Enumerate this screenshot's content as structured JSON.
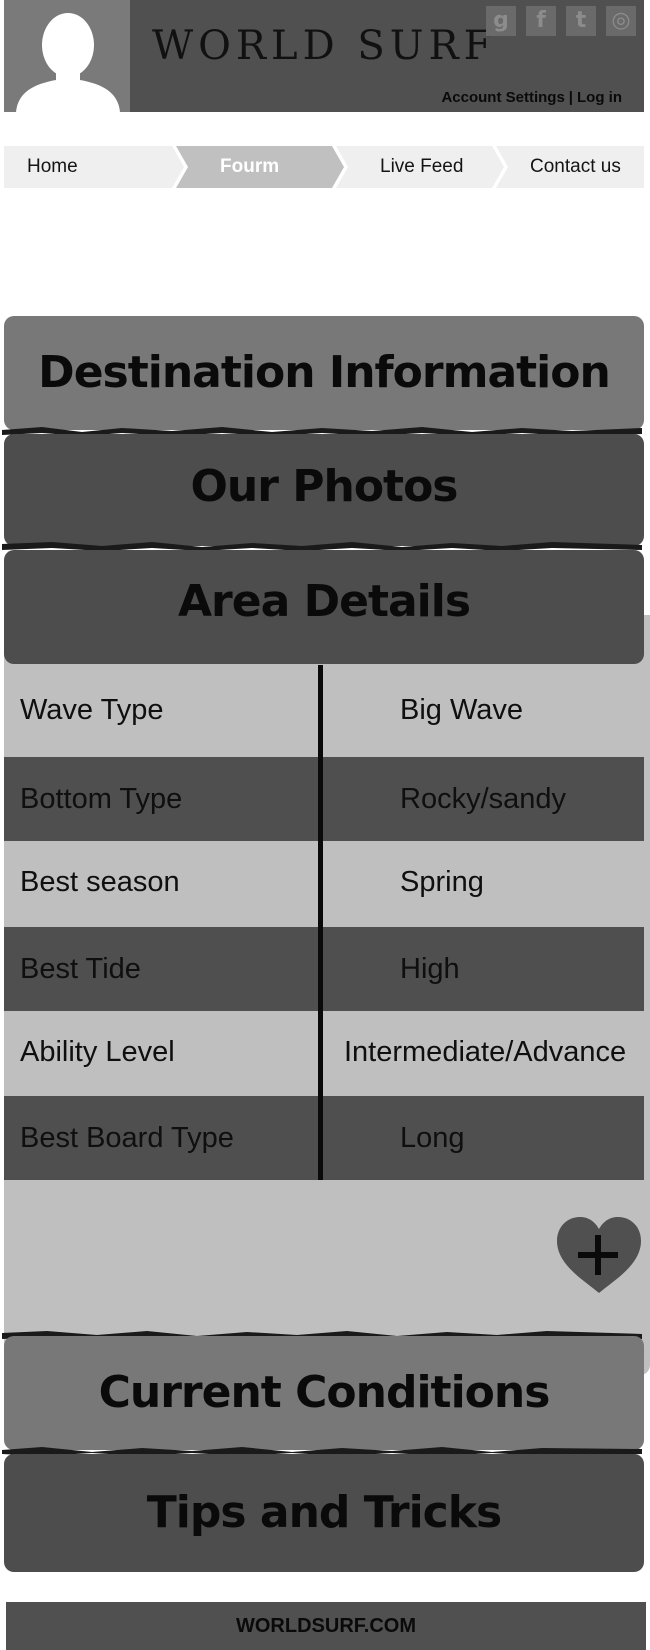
{
  "header": {
    "logo": "WORLD SURF",
    "social": [
      {
        "label": "g",
        "icon": "google-icon"
      },
      {
        "label": "f",
        "icon": "facebook-icon"
      },
      {
        "label": "t",
        "icon": "twitter-icon"
      },
      {
        "label": "◎",
        "icon": "instagram-icon"
      }
    ],
    "account_settings": "Account Settings",
    "separator": "|",
    "login": "Log in"
  },
  "nav": {
    "items": [
      {
        "label": "Home"
      },
      {
        "label": "Fourm"
      },
      {
        "label": "Live Feed"
      },
      {
        "label": "Contact us"
      }
    ],
    "active_index": 1
  },
  "sections": {
    "destination": "Destination Information",
    "photos": "Our Photos",
    "area_details": "Area Details",
    "current_conditions": "Current Conditions",
    "tips": "Tips and Tricks"
  },
  "details": {
    "rows": [
      {
        "label": "Wave Type",
        "value": "Big Wave"
      },
      {
        "label": "Bottom Type",
        "value": "Rocky/sandy"
      },
      {
        "label": "Best season",
        "value": "Spring"
      },
      {
        "label": "Best Tide",
        "value": "High"
      },
      {
        "label": "Ability Level",
        "value": "Intermediate/Advance"
      },
      {
        "label": "Best Board Type",
        "value": "Long"
      }
    ]
  },
  "footer": {
    "text": "WORLDSURF.COM"
  },
  "colors": {
    "header_bg": "#505050",
    "section_light": "#787878",
    "section_dark": "#4d4d4d",
    "panel_bg": "#bfbfbf",
    "row_dark": "#4f4f4f",
    "nav_active": "#c0c0c0",
    "nav_inactive": "#efefef"
  }
}
